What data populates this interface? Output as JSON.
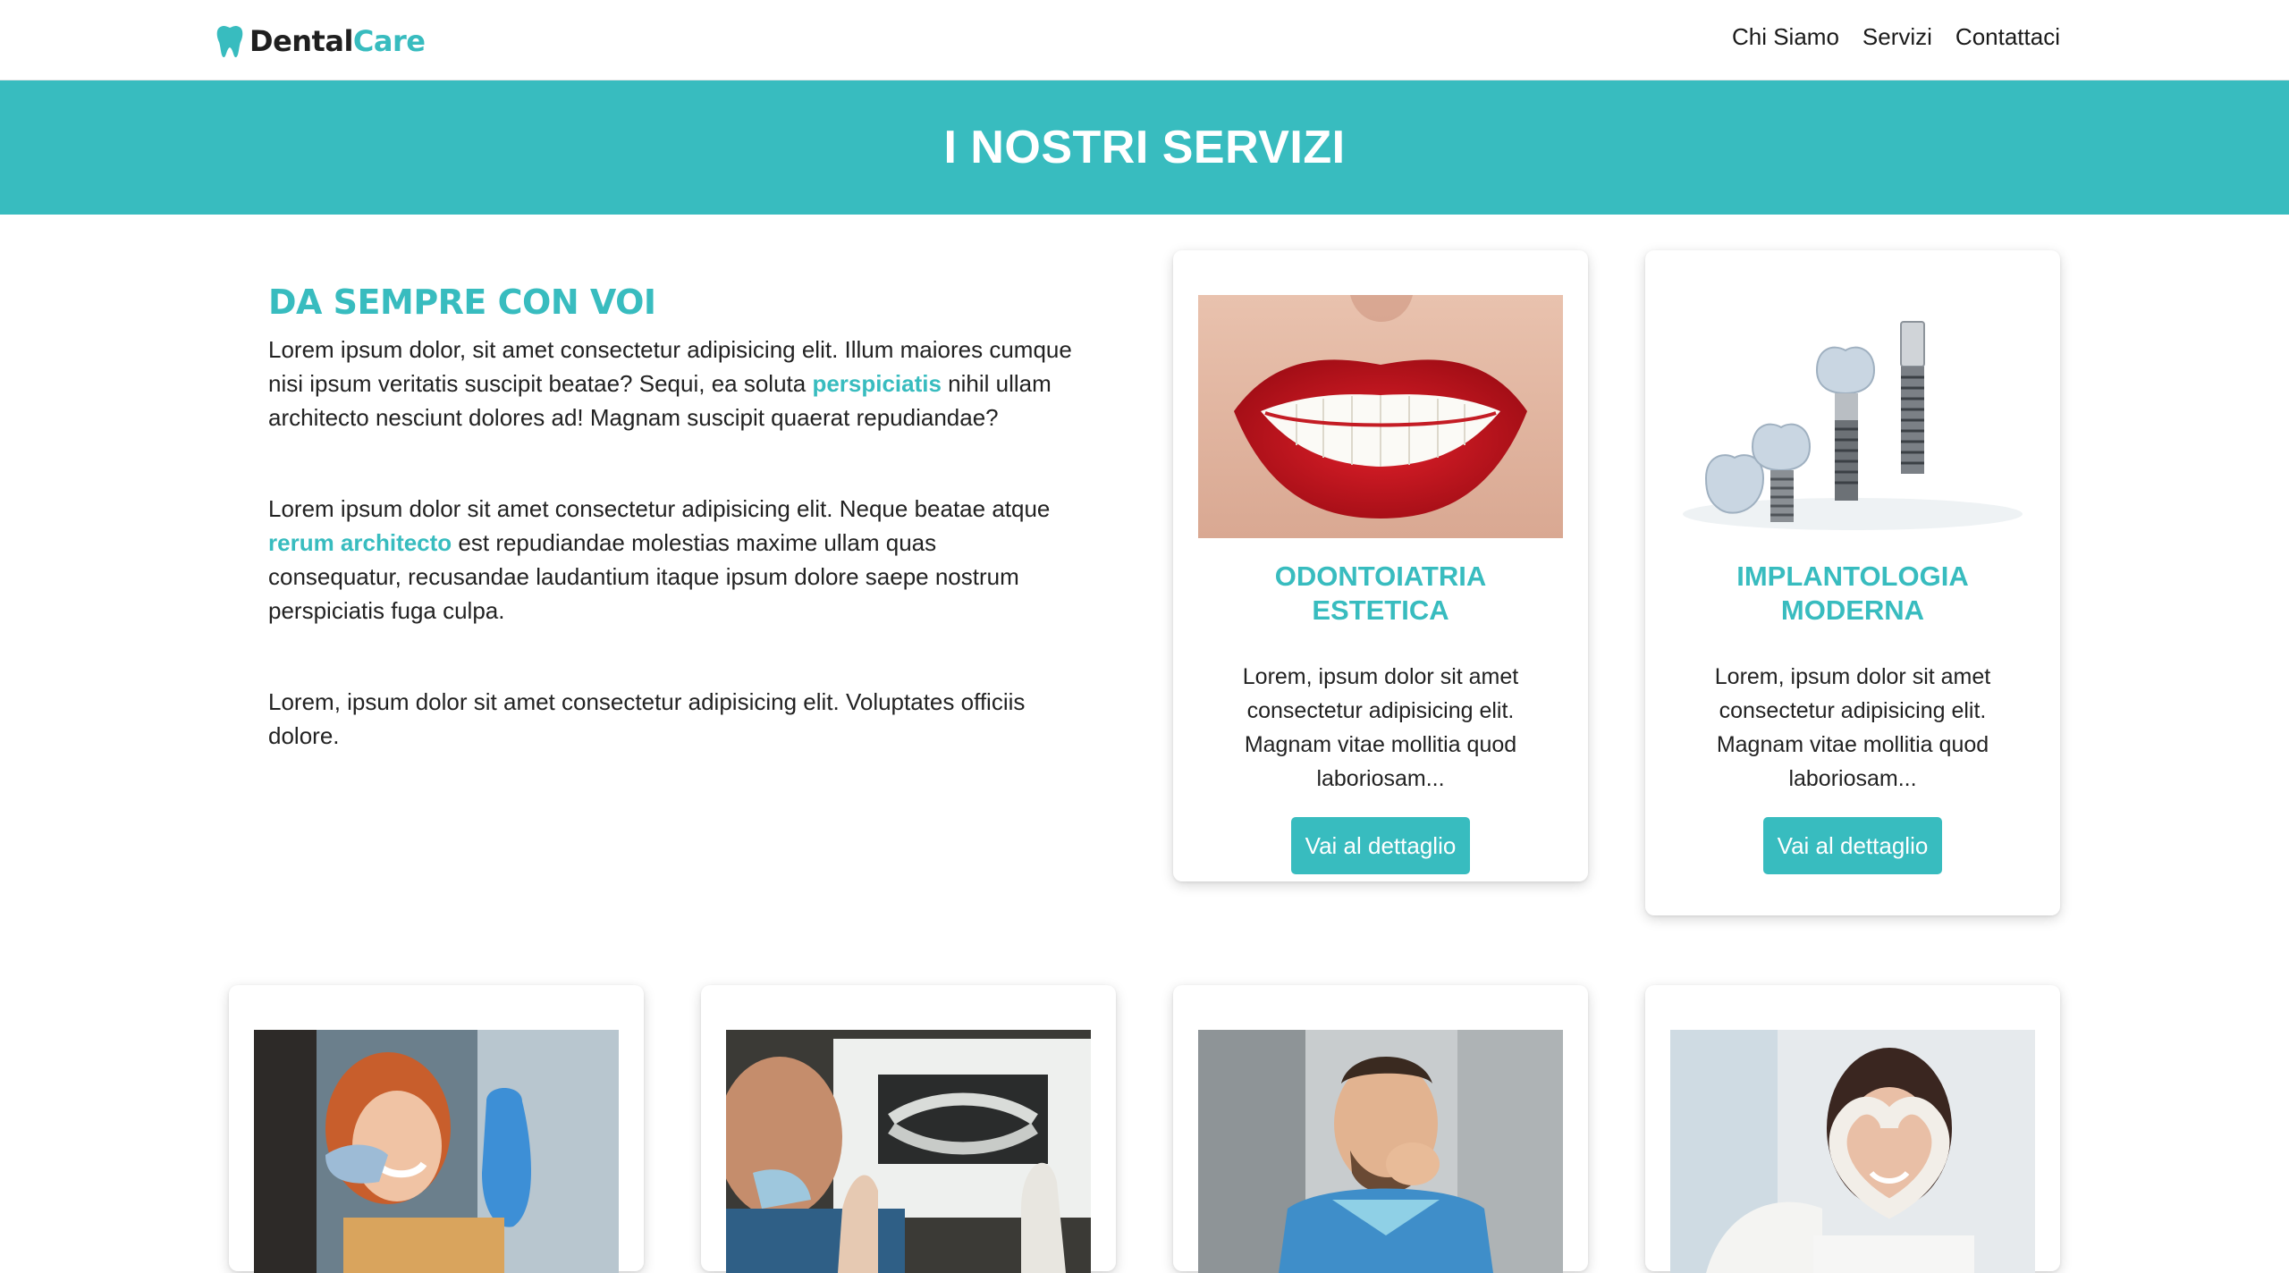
{
  "navbar": {
    "brand_part1": "Dental",
    "brand_part2": "Care",
    "links": [
      "Chi Siamo",
      "Servizi",
      "Contattaci"
    ]
  },
  "hero": {
    "title": "I NOSTRI SERVIZI"
  },
  "intro": {
    "heading": "DA SEMPRE CON VOI",
    "p1_before": "Lorem ipsum dolor, sit amet consectetur adipisicing elit. Illum maiores cumque nisi ipsum veritatis suscipit beatae? Sequi, ea soluta ",
    "p1_link": "perspiciatis",
    "p1_after": " nihil ullam architecto nesciunt dolores ad! Magnam suscipit quaerat repudiandae?",
    "p2_before": "Lorem ipsum dolor sit amet consectetur adipisicing elit. Neque beatae atque ",
    "p2_link": "rerum architecto",
    "p2_after": " est repudiandae molestias maxime ullam quas consequatur, recusandae laudantium itaque ipsum dolore saepe nostrum perspiciatis fuga culpa.",
    "p3": "Lorem, ipsum dolor sit amet consectetur adipisicing elit. Voluptates officiis dolore."
  },
  "cards": [
    {
      "title": "ODONTOIATRIA ESTETICA",
      "text": "Lorem, ipsum dolor sit amet consectetur adipisicing elit. Magnam vitae mollitia quod laboriosam...",
      "button": "Vai al dettaglio",
      "image": "smile-photo"
    },
    {
      "title": "IMPLANTOLOGIA MODERNA",
      "text": "Lorem, ipsum dolor sit amet consectetur adipisicing elit. Magnam vitae mollitia quod laboriosam...",
      "button": "Vai al dettaglio",
      "image": "dental-implants-photo"
    },
    {
      "image": "patient-mirror-photo"
    },
    {
      "image": "xray-photo"
    },
    {
      "image": "toothache-photo"
    },
    {
      "image": "heart-hands-photo"
    }
  ],
  "colors": {
    "accent": "#38bcbf",
    "text": "#222222",
    "background": "#ffffff"
  }
}
